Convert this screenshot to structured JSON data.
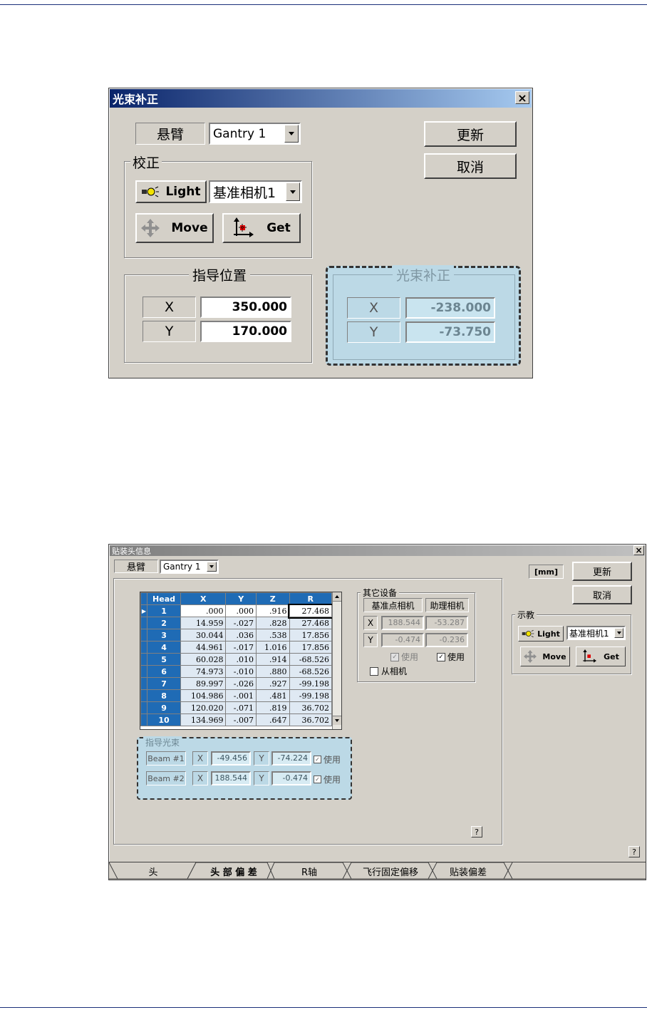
{
  "dialog1": {
    "title": "光束补正",
    "close": "×",
    "gantry_label": "悬臂",
    "gantry_value": "Gantry 1",
    "update_btn": "更新",
    "cancel_btn": "取消",
    "calib_group": "校正",
    "light_btn": "Light",
    "camera_value": "基准相机1",
    "move_btn": "Move",
    "get_btn": "Get",
    "guide_group": "指导位置",
    "guide_x_label": "X",
    "guide_x": "350.000",
    "guide_y_label": "Y",
    "guide_y": "170.000",
    "beam_group": "光束补正",
    "beam_x_label": "X",
    "beam_x": "-238.000",
    "beam_y_label": "Y",
    "beam_y": "-73.750"
  },
  "dialog2": {
    "title": "贴装头信息",
    "close": "×",
    "gantry_label": "悬臂",
    "gantry_value": "Gantry 1",
    "unit": "[mm]",
    "update_btn": "更新",
    "cancel_btn": "取消",
    "teach_group": "示教",
    "light_btn": "Light",
    "camera_value": "基准相机1",
    "move_btn": "Move",
    "get_btn": "Get",
    "table": {
      "headers": [
        "Head",
        "X",
        "Y",
        "Z",
        "R"
      ],
      "rows": [
        [
          "1",
          ".000",
          ".000",
          ".916",
          "27.468"
        ],
        [
          "2",
          "14.959",
          "-.027",
          ".828",
          "27.468"
        ],
        [
          "3",
          "30.044",
          ".036",
          ".538",
          "17.856"
        ],
        [
          "4",
          "44.961",
          "-.017",
          "1.016",
          "17.856"
        ],
        [
          "5",
          "60.028",
          ".010",
          ".914",
          "-68.526"
        ],
        [
          "6",
          "74.973",
          "-.010",
          ".880",
          "-68.526"
        ],
        [
          "7",
          "89.997",
          "-.026",
          ".927",
          "-99.198"
        ],
        [
          "8",
          "104.986",
          "-.001",
          ".481",
          "-99.198"
        ],
        [
          "9",
          "120.020",
          "-.071",
          ".819",
          "36.702"
        ],
        [
          "10",
          "134.969",
          "-.007",
          ".647",
          "36.702"
        ]
      ]
    },
    "other_group": "其它设备",
    "ref_camera": "基准点相机",
    "aux_camera": "助理相机",
    "other_x_label": "X",
    "other_y_label": "Y",
    "ref_x": "188.544",
    "aux_x": "-53.287",
    "ref_y": "-0.474",
    "aux_y": "-0.236",
    "ref_use": "使用",
    "aux_use": "使用",
    "slave_camera": "从相机",
    "guide_group": "指导光束",
    "beam1_label": "Beam #1",
    "beam1_x_label": "X",
    "beam1_x": "-49.456",
    "beam1_y_label": "Y",
    "beam1_y": "-74.224",
    "beam1_use": "使用",
    "beam2_label": "Beam #2",
    "beam2_x_label": "X",
    "beam2_x": "188.544",
    "beam2_y_label": "Y",
    "beam2_y": "-0.474",
    "beam2_use": "使用",
    "help": "?",
    "tabs": [
      "头",
      "头 部 偏 差",
      "R轴",
      "飞行固定偏移",
      "贴装偏差"
    ]
  }
}
